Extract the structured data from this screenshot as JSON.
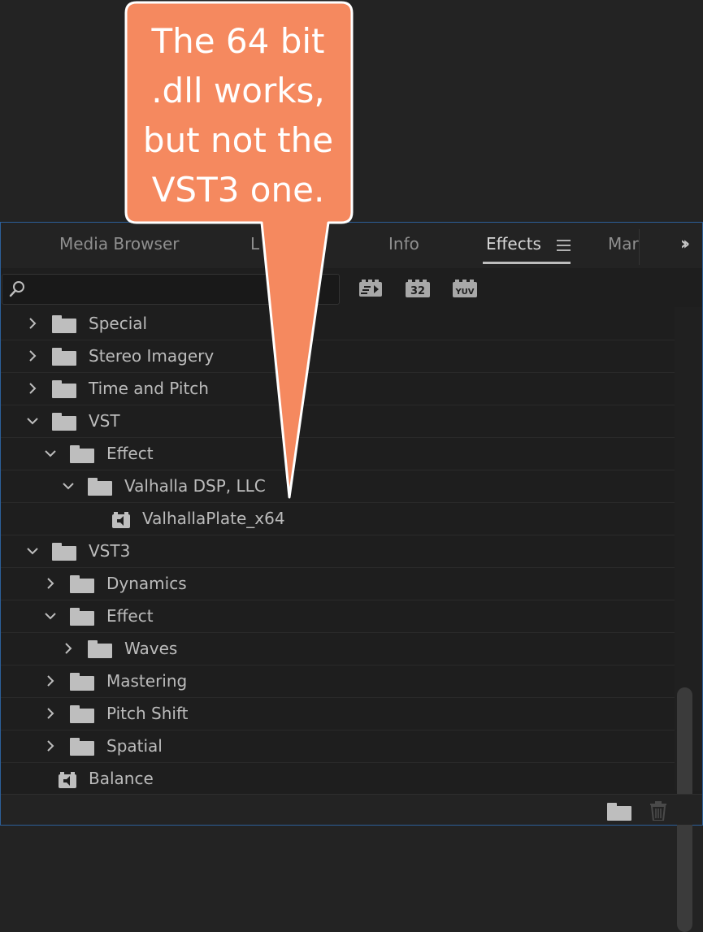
{
  "callout": {
    "line1": "The 64 bit",
    "line2": ".dll works,",
    "line3": "but not the",
    "line4": "VST3 one."
  },
  "tabs": {
    "media_browser": "Media Browser",
    "hidden_tab": "L",
    "info": "Info",
    "effects": "Effects",
    "markers_clipped": "Mar"
  },
  "search": {
    "value": "",
    "placeholder": ""
  },
  "filter_buttons": {
    "accelerated": "accelerated-effects-icon",
    "bit32": "32",
    "yuv": "YUV"
  },
  "tree": {
    "rows": [
      {
        "label": "Special",
        "icon": "folder-icon",
        "state": "collapsed",
        "level": 0
      },
      {
        "label": "Stereo Imagery",
        "icon": "folder-icon",
        "state": "collapsed",
        "level": 0
      },
      {
        "label": "Time and Pitch",
        "icon": "folder-icon",
        "state": "collapsed",
        "level": 0
      },
      {
        "label": "VST",
        "icon": "folder-icon",
        "state": "expanded",
        "level": 0
      },
      {
        "label": "Effect",
        "icon": "folder-icon",
        "state": "expanded",
        "level": 1
      },
      {
        "label": "Valhalla DSP, LLC",
        "icon": "folder-icon",
        "state": "expanded",
        "level": 2
      },
      {
        "label": "ValhallaPlate_x64",
        "icon": "audio-effect-icon",
        "state": "leaf",
        "level": 3
      },
      {
        "label": "VST3",
        "icon": "folder-icon",
        "state": "expanded",
        "level": 0
      },
      {
        "label": "Dynamics",
        "icon": "folder-icon",
        "state": "collapsed",
        "level": 1
      },
      {
        "label": "Effect",
        "icon": "folder-icon",
        "state": "expanded",
        "level": 1
      },
      {
        "label": "Waves",
        "icon": "folder-icon",
        "state": "collapsed",
        "level": 2
      },
      {
        "label": "Mastering",
        "icon": "folder-icon",
        "state": "collapsed",
        "level": 1
      },
      {
        "label": "Pitch Shift",
        "icon": "folder-icon",
        "state": "collapsed",
        "level": 1
      },
      {
        "label": "Spatial",
        "icon": "folder-icon",
        "state": "collapsed",
        "level": 1
      },
      {
        "label": "Balance",
        "icon": "audio-effect-icon",
        "state": "leaf",
        "level": 1
      }
    ]
  },
  "colors": {
    "callout_fill": "#f5895f",
    "panel_focus_border": "#2c5f99",
    "panel_bg": "#1e1e1e"
  }
}
